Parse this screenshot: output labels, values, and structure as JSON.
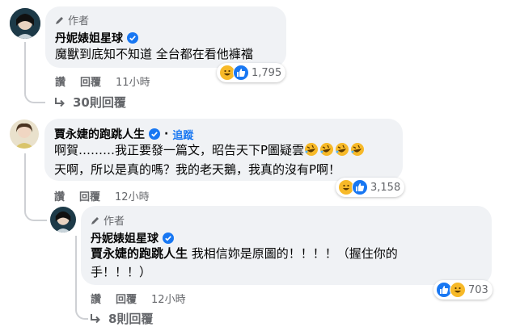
{
  "comments": [
    {
      "author_tag": "作者",
      "name": "丹妮婊姐星球",
      "text_lines": [
        "魔獸到底知不知道 全台都在看他褲襠"
      ],
      "actions": {
        "like": "讚",
        "reply": "回覆",
        "time": "11小時"
      },
      "reaction_count": "1,795",
      "reaction_icons": [
        "haha",
        "like"
      ],
      "replies_label": "30則回覆"
    },
    {
      "name": "賈永婕的跑跳人生",
      "follow_label": "追蹤",
      "text_line1": "啊賀………我正要發一篇文，昭告天下P圖疑雲",
      "text_line2": "天啊，所以是真的嗎？我的老天鵝，我真的沒有P啊！",
      "emoji_count": 4,
      "actions": {
        "like": "讚",
        "reply": "回覆",
        "time": "12小時"
      },
      "reaction_count": "3,158",
      "reaction_icons": [
        "haha",
        "like"
      ]
    },
    {
      "author_tag": "作者",
      "name": "丹妮婊姐星球",
      "mention": "賈永婕的跑跳人生",
      "text_rest1": " 我相信妳是原圖的！！！！（握住你的",
      "text_line2": "手！！！）",
      "actions": {
        "like": "讚",
        "reply": "回覆",
        "time": "12小時"
      },
      "reaction_count": "703",
      "reaction_icons": [
        "like",
        "haha"
      ],
      "replies_label": "8則回覆"
    }
  ],
  "colors": {
    "accent": "#1877f2",
    "bubble": "#f0f2f5",
    "muted": "#65676b"
  }
}
